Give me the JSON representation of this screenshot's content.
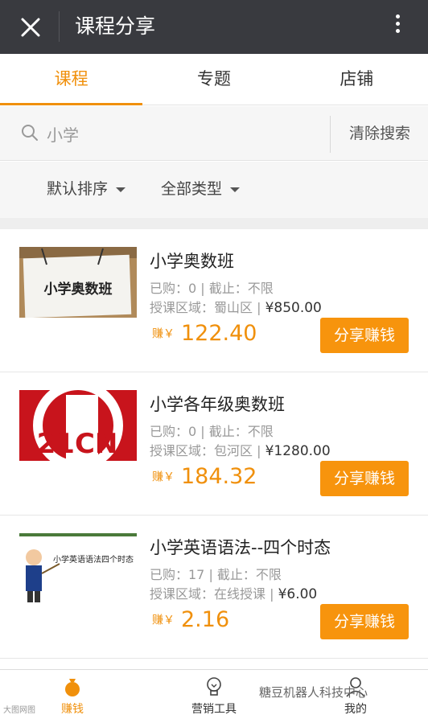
{
  "header": {
    "title": "课程分享"
  },
  "tabs": [
    {
      "label": "课程",
      "active": true
    },
    {
      "label": "专题",
      "active": false
    },
    {
      "label": "店铺",
      "active": false
    }
  ],
  "search": {
    "value": "小学",
    "clear_label": "清除搜索"
  },
  "filters": {
    "sort_label": "默认排序",
    "type_label": "全部类型"
  },
  "courses": [
    {
      "name": "小学奥数班",
      "bought": "已购：0 | 截止：不限",
      "area": "授课区域：蜀山区 | ",
      "price": "¥850.00",
      "earn_label": "赚￥",
      "earn_amount": "122.40",
      "share_label": "分享赚钱",
      "thumb_text": "小学奥数班"
    },
    {
      "name": "小学各年级奥数班",
      "bought": "已购：0 | 截止：不限",
      "area": "授课区域：包河区 | ",
      "price": "¥1280.00",
      "earn_label": "赚￥",
      "earn_amount": "184.32",
      "share_label": "分享赚钱",
      "thumb_text": "21CN"
    },
    {
      "name": "小学英语语法--四个时态",
      "bought": "已购：17 | 截止：不限",
      "area": "授课区域：在线授课 | ",
      "price": "¥6.00",
      "earn_label": "赚￥",
      "earn_amount": "2.16",
      "share_label": "分享赚钱",
      "thumb_text": "小学英语语法四个时态"
    }
  ],
  "bottom_nav": [
    {
      "label": "赚钱",
      "icon": "money-bag-icon",
      "active": true
    },
    {
      "label": "营销工具",
      "icon": "bulb-icon",
      "active": false
    },
    {
      "label": "我的",
      "icon": "user-icon",
      "active": false
    }
  ],
  "watermark": "糖豆机器人科技中心",
  "watermark_small": "大图网图",
  "colors": {
    "accent": "#f0900c",
    "topbar": "#393a3f",
    "button": "#f7940d"
  }
}
